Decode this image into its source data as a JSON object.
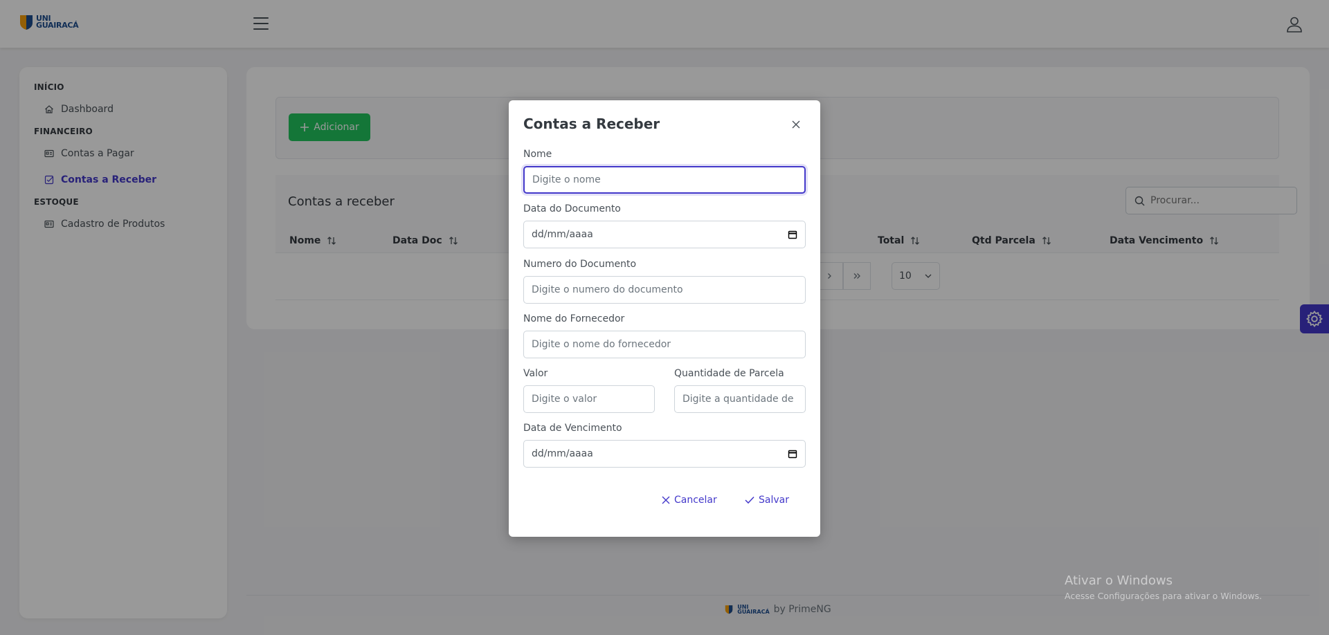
{
  "brand": {
    "logo_line1": "UNI",
    "logo_line2": "GUAIRACÁ"
  },
  "sidebar": {
    "sections": [
      {
        "title": "INÍCIO",
        "items": [
          {
            "label": "Dashboard",
            "icon": "home-icon"
          }
        ]
      },
      {
        "title": "FINANCEIRO",
        "items": [
          {
            "label": "Contas a Pagar",
            "icon": "id-card-icon"
          },
          {
            "label": "Contas a Receber",
            "icon": "check-square-icon",
            "active": true
          }
        ]
      },
      {
        "title": "ESTOQUE",
        "items": [
          {
            "label": "Cadastro de Produtos",
            "icon": "id-card-icon"
          }
        ]
      }
    ]
  },
  "toolbar": {
    "add_label": "Adicionar"
  },
  "table": {
    "title": "Contas a receber",
    "search_placeholder": "Procurar...",
    "columns": [
      "Nome",
      "Data Doc",
      "Total",
      "Qtd Parcela",
      "Data Vencimento"
    ],
    "rows_per_page": "10"
  },
  "footer": {
    "by_text": "by PrimeNG"
  },
  "watermark": {
    "title": "Ativar o Windows",
    "subtitle": "Acesse Configurações para ativar o Windows."
  },
  "dialog": {
    "title": "Contas a Receber",
    "fields": {
      "nome": {
        "label": "Nome",
        "placeholder": "Digite o nome"
      },
      "data_documento": {
        "label": "Data do Documento",
        "value": "dd/mm/aaaa"
      },
      "numero_documento": {
        "label": "Numero do Documento",
        "placeholder": "Digite o numero do documento"
      },
      "nome_fornecedor": {
        "label": "Nome do Fornecedor",
        "placeholder": "Digite o nome do fornecedor"
      },
      "valor": {
        "label": "Valor",
        "placeholder": "Digite o valor"
      },
      "quantidade_parcela": {
        "label": "Quantidade de Parcela",
        "placeholder": "Digite a quantidade de pa"
      },
      "data_vencimento": {
        "label": "Data de Vencimento",
        "value": "dd/mm/aaaa"
      }
    },
    "cancel_label": "Cancelar",
    "save_label": "Salvar"
  },
  "colors": {
    "primary": "#4338ca",
    "success": "#22c55e"
  }
}
